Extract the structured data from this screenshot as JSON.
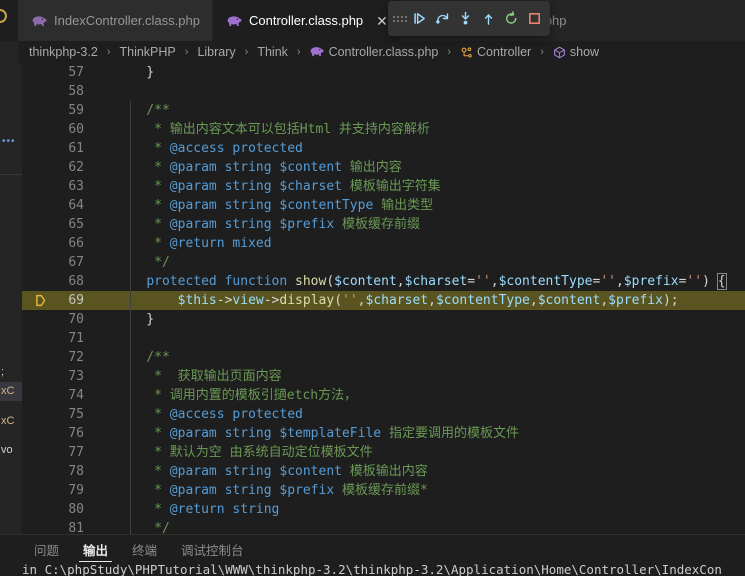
{
  "window": {
    "theme_bg": "#1e1e1e",
    "accent": "#569cd6",
    "current_line_highlight": "#5a5520"
  },
  "tabs": [
    {
      "label": "IndexController.class.php",
      "icon": "php-elephant-icon",
      "active": false,
      "closable": false
    },
    {
      "label": "Controller.class.php",
      "icon": "php-elephant-icon",
      "active": true,
      "closable": true,
      "close_label": "✕"
    },
    {
      "label": "Exception.class.php",
      "icon": "php-elephant-icon",
      "active": false,
      "closable": false
    }
  ],
  "debug_toolbar": {
    "buttons": [
      {
        "name": "drag-handle",
        "title": "Drag"
      },
      {
        "name": "continue-button",
        "title": "Continue",
        "color": "#9cdcfe"
      },
      {
        "name": "step-over-button",
        "title": "Step Over",
        "color": "#9cdcfe"
      },
      {
        "name": "step-into-button",
        "title": "Step Into",
        "color": "#9cdcfe"
      },
      {
        "name": "step-out-button",
        "title": "Step Out",
        "color": "#9cdcfe"
      },
      {
        "name": "restart-button",
        "title": "Restart",
        "color": "#89d185"
      },
      {
        "name": "stop-button",
        "title": "Stop",
        "color": "#f48771"
      }
    ]
  },
  "breadcrumbs": [
    {
      "label": "thinkphp-3.2",
      "icon": ""
    },
    {
      "label": "ThinkPHP",
      "icon": ""
    },
    {
      "label": "Library",
      "icon": ""
    },
    {
      "label": "Think",
      "icon": ""
    },
    {
      "label": "Controller.class.php",
      "icon": "php-elephant-icon"
    },
    {
      "label": "Controller",
      "icon": "class-symbol-icon"
    },
    {
      "label": "show",
      "icon": "method-symbol-icon"
    }
  ],
  "breadcrumb_separator": "›",
  "debug_sidebar": {
    "fragments": [
      "xC",
      "xC",
      "vo"
    ]
  },
  "editor": {
    "current_line": 69,
    "lines": [
      {
        "num": 57,
        "tokens": [
          {
            "t": "    }",
            "c": "t-punc"
          }
        ]
      },
      {
        "num": 58,
        "tokens": []
      },
      {
        "num": 59,
        "tokens": [
          {
            "t": "    /**",
            "c": "t-com"
          }
        ]
      },
      {
        "num": 60,
        "tokens": [
          {
            "t": "     * ",
            "c": "t-com"
          },
          {
            "t": "输出内容文本可以包括Html 并支持内容解析",
            "c": "t-com"
          }
        ]
      },
      {
        "num": 61,
        "tokens": [
          {
            "t": "     * ",
            "c": "t-com"
          },
          {
            "t": "@access protected",
            "c": "t-doctag"
          }
        ]
      },
      {
        "num": 62,
        "tokens": [
          {
            "t": "     * ",
            "c": "t-com"
          },
          {
            "t": "@param string $content",
            "c": "t-doctag"
          },
          {
            "t": " 输出内容",
            "c": "t-com"
          }
        ]
      },
      {
        "num": 63,
        "tokens": [
          {
            "t": "     * ",
            "c": "t-com"
          },
          {
            "t": "@param string $charset",
            "c": "t-doctag"
          },
          {
            "t": " 模板输出字符集",
            "c": "t-com"
          }
        ]
      },
      {
        "num": 64,
        "tokens": [
          {
            "t": "     * ",
            "c": "t-com"
          },
          {
            "t": "@param string $contentType",
            "c": "t-doctag"
          },
          {
            "t": " 输出类型",
            "c": "t-com"
          }
        ]
      },
      {
        "num": 65,
        "tokens": [
          {
            "t": "     * ",
            "c": "t-com"
          },
          {
            "t": "@param string $prefix",
            "c": "t-doctag"
          },
          {
            "t": " 模板缓存前缀",
            "c": "t-com"
          }
        ]
      },
      {
        "num": 66,
        "tokens": [
          {
            "t": "     * ",
            "c": "t-com"
          },
          {
            "t": "@return mixed",
            "c": "t-doctag"
          }
        ]
      },
      {
        "num": 67,
        "tokens": [
          {
            "t": "     */",
            "c": "t-com"
          }
        ]
      },
      {
        "num": 68,
        "tokens": [
          {
            "t": "    ",
            "c": "t-plain"
          },
          {
            "t": "protected function",
            "c": "t-kw"
          },
          {
            "t": " ",
            "c": "t-plain"
          },
          {
            "t": "show",
            "c": "t-fn"
          },
          {
            "t": "(",
            "c": "t-punc"
          },
          {
            "t": "$content",
            "c": "t-var"
          },
          {
            "t": ",",
            "c": "t-punc"
          },
          {
            "t": "$charset",
            "c": "t-var"
          },
          {
            "t": "=",
            "c": "t-punc"
          },
          {
            "t": "''",
            "c": "t-str"
          },
          {
            "t": ",",
            "c": "t-punc"
          },
          {
            "t": "$contentType",
            "c": "t-var"
          },
          {
            "t": "=",
            "c": "t-punc"
          },
          {
            "t": "''",
            "c": "t-str"
          },
          {
            "t": ",",
            "c": "t-punc"
          },
          {
            "t": "$prefix",
            "c": "t-var"
          },
          {
            "t": "=",
            "c": "t-punc"
          },
          {
            "t": "''",
            "c": "t-str"
          },
          {
            "t": ") ",
            "c": "t-punc"
          },
          {
            "t": "{",
            "c": "t-punc bracket-box"
          }
        ]
      },
      {
        "num": 69,
        "current": true,
        "tokens": [
          {
            "t": "        ",
            "c": "t-plain"
          },
          {
            "t": "$this",
            "c": "t-var"
          },
          {
            "t": "->",
            "c": "t-punc"
          },
          {
            "t": "view",
            "c": "t-var"
          },
          {
            "t": "->",
            "c": "t-punc"
          },
          {
            "t": "display",
            "c": "t-fn"
          },
          {
            "t": "(",
            "c": "t-punc"
          },
          {
            "t": "''",
            "c": "t-str"
          },
          {
            "t": ",",
            "c": "t-punc"
          },
          {
            "t": "$charset",
            "c": "t-var"
          },
          {
            "t": ",",
            "c": "t-punc"
          },
          {
            "t": "$contentType",
            "c": "t-var"
          },
          {
            "t": ",",
            "c": "t-punc"
          },
          {
            "t": "$content",
            "c": "t-var"
          },
          {
            "t": ",",
            "c": "t-punc"
          },
          {
            "t": "$prefix",
            "c": "t-var"
          },
          {
            "t": ");",
            "c": "t-punc"
          }
        ]
      },
      {
        "num": 70,
        "tokens": [
          {
            "t": "    }",
            "c": "t-punc"
          }
        ]
      },
      {
        "num": 71,
        "tokens": []
      },
      {
        "num": 72,
        "tokens": [
          {
            "t": "    /**",
            "c": "t-com"
          }
        ]
      },
      {
        "num": 73,
        "tokens": [
          {
            "t": "     *  获取输出页面内容",
            "c": "t-com"
          }
        ]
      },
      {
        "num": 74,
        "tokens": [
          {
            "t": "     * 调用内置的模板引擿etch方法，",
            "c": "t-com"
          }
        ]
      },
      {
        "num": 75,
        "tokens": [
          {
            "t": "     * ",
            "c": "t-com"
          },
          {
            "t": "@access protected",
            "c": "t-doctag"
          }
        ]
      },
      {
        "num": 76,
        "tokens": [
          {
            "t": "     * ",
            "c": "t-com"
          },
          {
            "t": "@param string $templateFile",
            "c": "t-doctag"
          },
          {
            "t": " 指定要调用的模板文件",
            "c": "t-com"
          }
        ]
      },
      {
        "num": 77,
        "tokens": [
          {
            "t": "     * 默认为空 由系统自动定位模板文件",
            "c": "t-com"
          }
        ]
      },
      {
        "num": 78,
        "tokens": [
          {
            "t": "     * ",
            "c": "t-com"
          },
          {
            "t": "@param string $content",
            "c": "t-doctag"
          },
          {
            "t": " 模板输出内容",
            "c": "t-com"
          }
        ]
      },
      {
        "num": 79,
        "tokens": [
          {
            "t": "     * ",
            "c": "t-com"
          },
          {
            "t": "@param string $prefix",
            "c": "t-doctag"
          },
          {
            "t": " 模板缓存前缀*",
            "c": "t-com"
          }
        ]
      },
      {
        "num": 80,
        "tokens": [
          {
            "t": "     * ",
            "c": "t-com"
          },
          {
            "t": "@return string",
            "c": "t-doctag"
          }
        ]
      },
      {
        "num": 81,
        "tokens": [
          {
            "t": "     */",
            "c": "t-com"
          }
        ]
      }
    ]
  },
  "panel": {
    "tabs": [
      {
        "label": "问题",
        "active": false
      },
      {
        "label": "输出",
        "active": true
      },
      {
        "label": "终端",
        "active": false
      },
      {
        "label": "调试控制台",
        "active": false
      }
    ],
    "output_line": "in C:\\phpStudy\\PHPTutorial\\WWW\\thinkphp-3.2\\thinkphp-3.2\\Application\\Home\\Controller\\IndexCon"
  }
}
